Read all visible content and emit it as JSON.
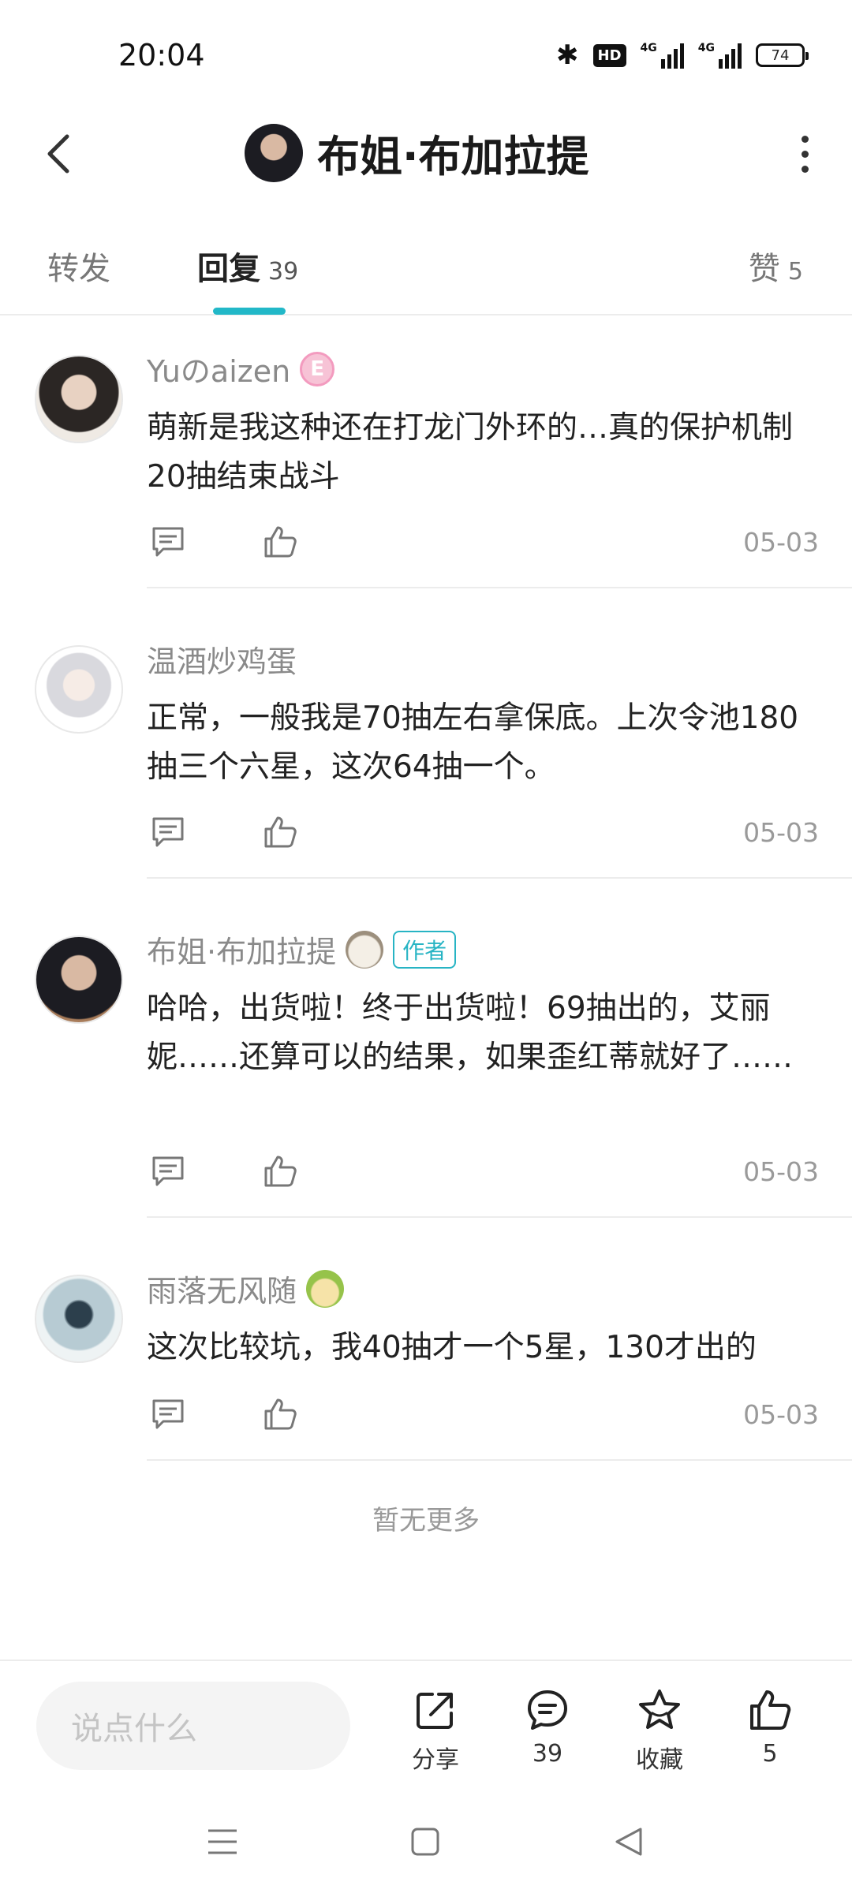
{
  "status_bar": {
    "time": "20:04",
    "hd": "HD",
    "net1": "4G",
    "net2": "4G",
    "battery": "74"
  },
  "header": {
    "title": "布姐·布加拉提"
  },
  "tabs": {
    "repost": {
      "label": "转发"
    },
    "reply": {
      "label": "回复",
      "count": "39"
    },
    "like": {
      "label": "赞",
      "count": "5"
    }
  },
  "comments": [
    {
      "name": "Yuのaizen",
      "text": "萌新是我这种还在打龙门外环的…真的保护机制20抽结束战斗",
      "date": "05-03"
    },
    {
      "name": "温酒炒鸡蛋",
      "text": "正常，一般我是70抽左右拿保底。上次令池180抽三个六星，这次64抽一个。",
      "date": "05-03"
    },
    {
      "name": "布姐·布加拉提",
      "author_badge": "作者",
      "text": "哈哈，出货啦！终于出货啦！69抽出的，艾丽妮……还算可以的结果，如果歪红蒂就好了……",
      "date": "05-03"
    },
    {
      "name": "雨落无风随",
      "text": "这次比较坑，我40抽才一个5星，130才出的",
      "date": "05-03"
    }
  ],
  "no_more": "暂无更多",
  "bottom_bar": {
    "input_placeholder": "说点什么",
    "share_label": "分享",
    "comment_count": "39",
    "favorite_label": "收藏",
    "like_count": "5"
  },
  "colors": {
    "accent": "#22b8c8",
    "badge_e": "#f39bbf"
  }
}
